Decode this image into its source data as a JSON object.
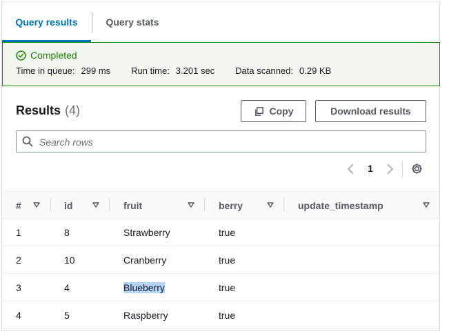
{
  "tabs": {
    "results": "Query results",
    "stats": "Query stats"
  },
  "status": {
    "label": "Completed",
    "queue_label": "Time in queue:",
    "queue_value": "299 ms",
    "run_label": "Run time:",
    "run_value": "3.201 sec",
    "scanned_label": "Data scanned:",
    "scanned_value": "0.29 KB",
    "color": "#1d8102"
  },
  "results": {
    "title": "Results",
    "count": "(4)",
    "copy_label": "Copy",
    "download_label": "Download results",
    "search_placeholder": "Search rows",
    "page": "1",
    "columns": [
      "#",
      "id",
      "fruit",
      "berry",
      "update_timestamp"
    ],
    "rows": [
      {
        "n": "1",
        "id": "8",
        "fruit": "Strawberry",
        "berry": "true",
        "update_timestamp": ""
      },
      {
        "n": "2",
        "id": "10",
        "fruit": "Cranberry",
        "berry": "true",
        "update_timestamp": ""
      },
      {
        "n": "3",
        "id": "4",
        "fruit": "Blueberry",
        "berry": "true",
        "update_timestamp": ""
      },
      {
        "n": "4",
        "id": "5",
        "fruit": "Raspberry",
        "berry": "true",
        "update_timestamp": ""
      }
    ]
  },
  "icons": [
    "check-circle-icon",
    "copy-icon",
    "search-icon",
    "chevron-left-icon",
    "chevron-right-icon",
    "gear-icon",
    "sort-caret-icon"
  ],
  "colors": {
    "accent": "#0073bb",
    "success": "#1d8102",
    "selection": "#b3d4fc"
  }
}
